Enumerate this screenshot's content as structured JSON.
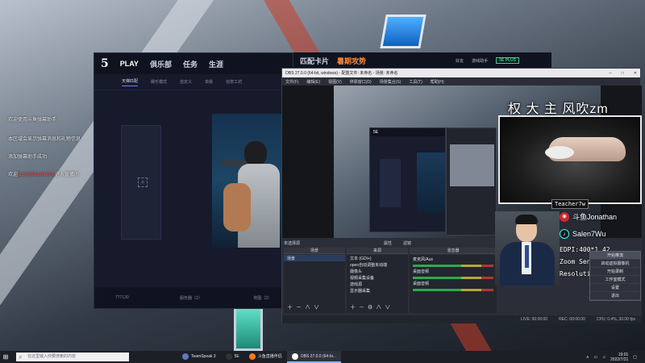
{
  "desktop": {
    "messages": [
      {
        "text": "欢迎使用斗鱼弹幕助手"
      },
      {
        "text": "本区域会显示弹幕消息和礼物信息"
      },
      {
        "text": "添加弹幕助手成功"
      },
      {
        "pre": "欢迎",
        "highlight": "[LV24]Teacher7w",
        "post": "进入直播间"
      }
    ]
  },
  "client": {
    "logo": "5",
    "nav": [
      "PLAY",
      "俱乐部",
      "任务",
      "生涯",
      "匹配卡片",
      "暑期攻势"
    ],
    "tabs": [
      "天梯匹配",
      "娱乐模式",
      "自定义",
      "单挑",
      "创意工坊"
    ],
    "slot_plus": "+",
    "bottom": {
      "online": "777130",
      "server": "服务器（2）",
      "map": "地图（2）"
    },
    "topbar_right": {
      "friends": "好友",
      "settings": "游戏助手",
      "plus": "5E PLUS"
    }
  },
  "obs": {
    "title": "OBS 27.0.0 (64-bit, windows) - 配置文件: 未命名 - 场景: 未命名",
    "menu": [
      "文件(F)",
      "编辑(E)",
      "视图(V)",
      "停靠窗口(D)",
      "场景集合(S)",
      "工具(T)",
      "帮助(H)"
    ],
    "preview_label": "5E",
    "no_source": "未选择源",
    "props_btn": "属性",
    "filter_btn": "滤镜",
    "docks": {
      "scenes": {
        "title": "场景",
        "items": [
          "场景"
        ]
      },
      "sources": {
        "title": "来源",
        "items": [
          "文本 (GDI+)",
          "open自动调整未动端",
          "摄像头",
          "视频采集设备",
          "游戏源",
          "显示器采集"
        ]
      },
      "mixer": {
        "title": "混音器",
        "items": [
          "麦克风/Aux",
          "桌面音频",
          "桌面音频"
        ]
      }
    },
    "controls_menu": [
      "开始推流",
      "启动虚拟摄像机",
      "开始录制",
      "工作室模式",
      "设置",
      "退出"
    ],
    "status": {
      "live": "LIVE: 00:00:00",
      "rec": "REC: 00:00:00",
      "cpu": "CPU: 0.4%, 30.00 fps"
    }
  },
  "overlay": {
    "title": "权 大 主 风吹zm",
    "tag": "Teacher7w",
    "weibo": "斗鱼Jonathan",
    "douyin": "Salen7Wu",
    "stats": [
      "EDPI:400*1.42",
      "Zoom Sensitivity:1.0",
      "Resolution:1.28"
    ]
  },
  "taskbar": {
    "search_placeholder": "在这里输入你要搜索的内容",
    "tasks": [
      {
        "label": "TeamSpeak 3"
      },
      {
        "label": "5E"
      },
      {
        "label": "斗鱼直播伴侣"
      },
      {
        "label": "OBS 27.0.0 (64-bi..."
      }
    ],
    "time": "19:01",
    "date": "2022/7/21"
  }
}
